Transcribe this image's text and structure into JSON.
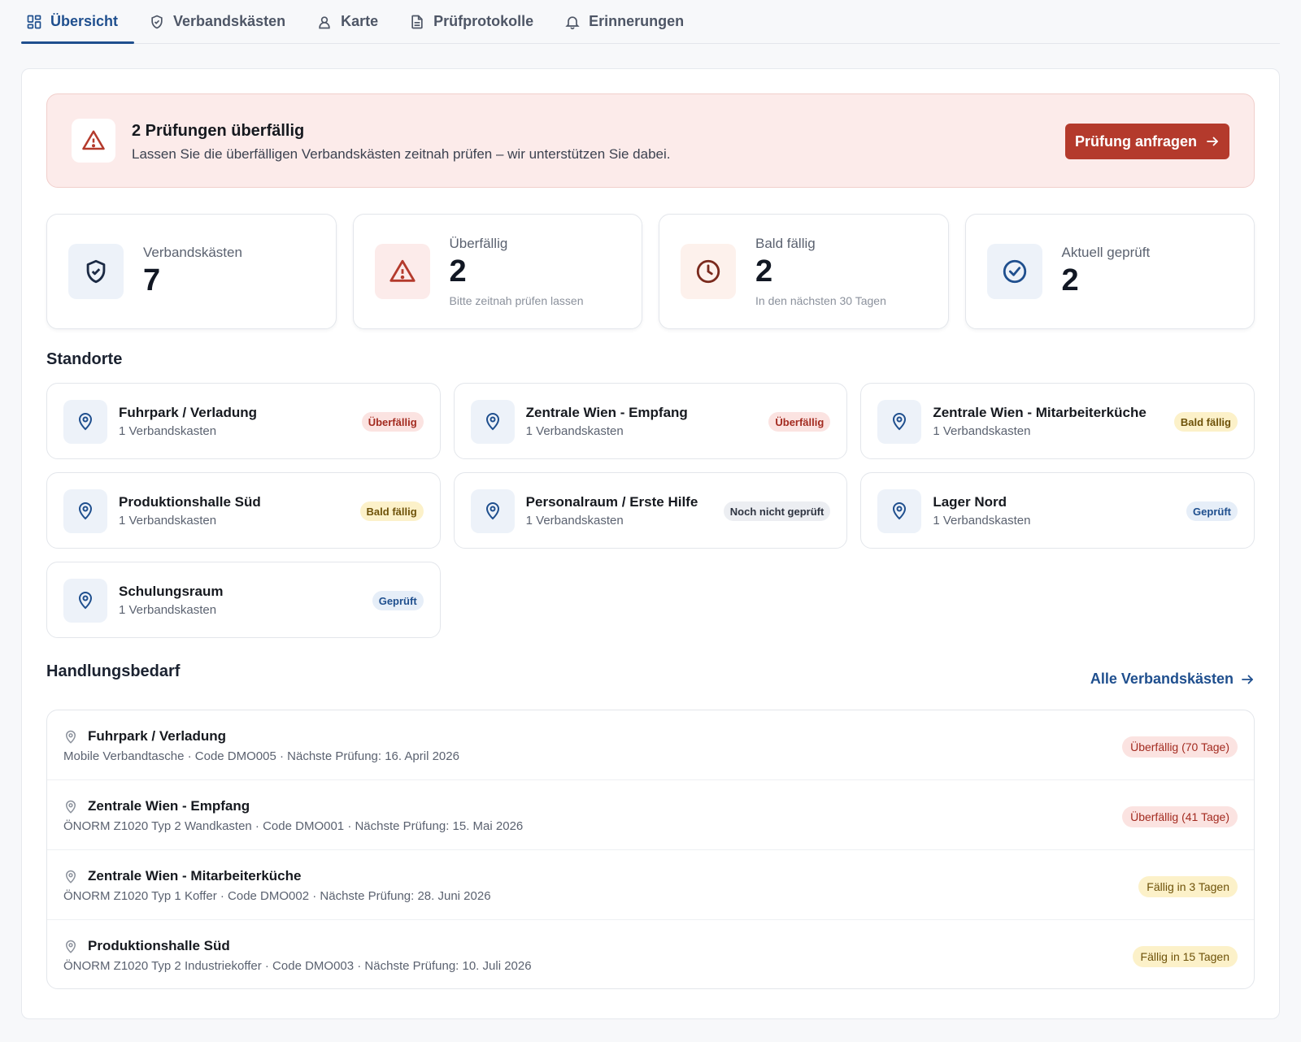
{
  "tabs": [
    {
      "label": "Übersicht",
      "icon": "dashboard-icon",
      "active": true
    },
    {
      "label": "Verbandskästen",
      "icon": "shield-icon"
    },
    {
      "label": "Karte",
      "icon": "user-pin-icon"
    },
    {
      "label": "Prüfprotokolle",
      "icon": "document-icon"
    },
    {
      "label": "Erinnerungen",
      "icon": "bell-icon"
    }
  ],
  "alert": {
    "icon": "warning-icon",
    "title": "2 Prüfungen überfällig",
    "text": "Lassen Sie die überfälligen Verbandskästen zeitnah prüfen – wir unterstützen Sie dabei.",
    "button_label": "Prüfung anfragen"
  },
  "stats": [
    {
      "label": "Verbandskästen",
      "value": "7",
      "sub": "",
      "icon": "shield-check-icon"
    },
    {
      "label": "Überfällig",
      "value": "2",
      "sub": "Bitte zeitnah prüfen lassen",
      "icon": "warning-icon"
    },
    {
      "label": "Bald fällig",
      "value": "2",
      "sub": "In den nächsten 30 Tagen",
      "icon": "clock-icon"
    },
    {
      "label": "Aktuell geprüft",
      "value": "2",
      "sub": "",
      "icon": "check-circle-icon"
    }
  ],
  "locations_title": "Standorte",
  "locations": [
    {
      "name": "Fuhrpark / Verladung",
      "count": "1 Verbandskasten",
      "status": "Überfällig",
      "status_type": "overdue"
    },
    {
      "name": "Zentrale Wien - Empfang",
      "count": "1 Verbandskasten",
      "status": "Überfällig",
      "status_type": "overdue"
    },
    {
      "name": "Zentrale Wien - Mitarbeiterküche",
      "count": "1 Verbandskasten",
      "status": "Bald fällig",
      "status_type": "soon"
    },
    {
      "name": "Produktionshalle Süd",
      "count": "1 Verbandskasten",
      "status": "Bald fällig",
      "status_type": "soon"
    },
    {
      "name": "Personalraum / Erste Hilfe",
      "count": "1 Verbandskasten",
      "status": "Noch nicht geprüft",
      "status_type": "unchecked"
    },
    {
      "name": "Lager Nord",
      "count": "1 Verbandskasten",
      "status": "Geprüft",
      "status_type": "checked"
    },
    {
      "name": "Schulungsraum",
      "count": "1 Verbandskasten",
      "status": "Geprüft",
      "status_type": "checked"
    }
  ],
  "actions_title": "Handlungsbedarf",
  "actions_link": "Alle Verbandskästen",
  "actions": [
    {
      "title": "Fuhrpark / Verladung",
      "meta": "Mobile Verbandtasche · Code DMO005 · Nächste Prüfung: 16. April 2026",
      "status": "Überfällig (70 Tage)",
      "status_type": "overdue"
    },
    {
      "title": "Zentrale Wien - Empfang",
      "meta": "ÖNORM Z1020 Typ 2 Wandkasten · Code DMO001 · Nächste Prüfung: 15. Mai 2026",
      "status": "Überfällig (41 Tage)",
      "status_type": "overdue"
    },
    {
      "title": "Zentrale Wien - Mitarbeiterküche",
      "meta": "ÖNORM Z1020 Typ 1 Koffer · Code DMO002 · Nächste Prüfung: 28. Juni 2026",
      "status": "Fällig in 3 Tagen",
      "status_type": "soon"
    },
    {
      "title": "Produktionshalle Süd",
      "meta": "ÖNORM Z1020 Typ 2 Industriekoffer · Code DMO003 · Nächste Prüfung: 10. Juli 2026",
      "status": "Fällig in 15 Tagen",
      "status_type": "soon"
    }
  ],
  "colors": {
    "primary": "#1f4f8e",
    "danger": "#b43a2c",
    "alert_bg": "#fcebea"
  }
}
